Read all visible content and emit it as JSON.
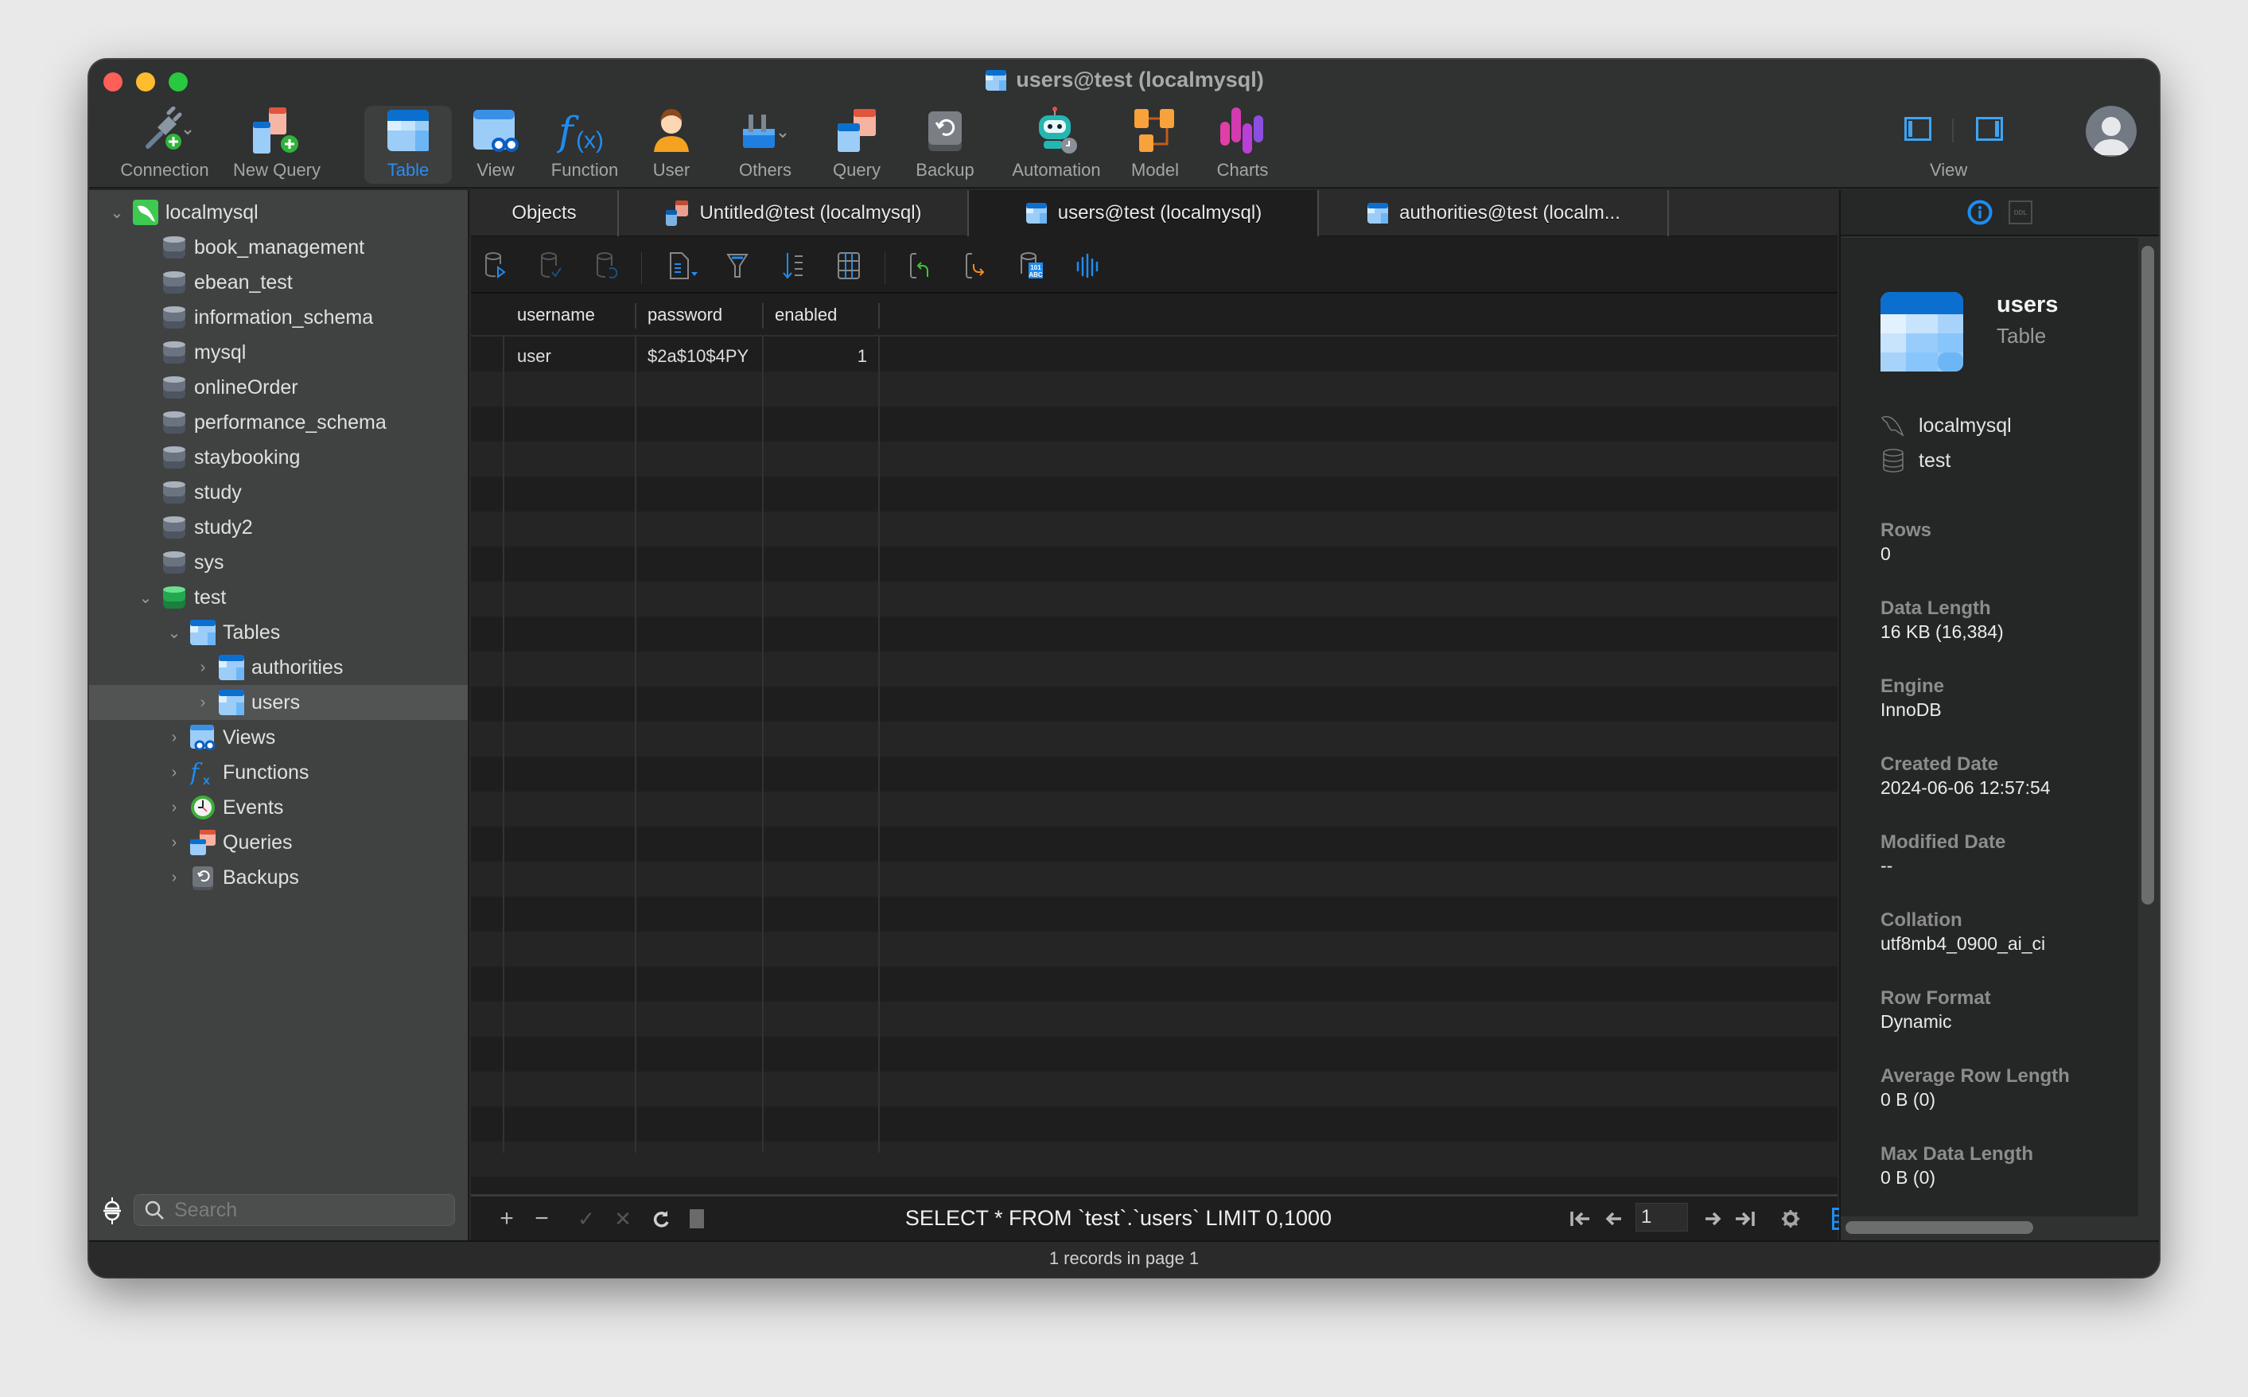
{
  "window": {
    "title": "users@test (localmysql)"
  },
  "toolbar": {
    "items": [
      {
        "label": "Connection",
        "icon": "connection-plug-icon"
      },
      {
        "label": "New Query",
        "icon": "new-query-icon"
      },
      {
        "label": "Table",
        "icon": "table-icon",
        "active": true
      },
      {
        "label": "View",
        "icon": "view-icon"
      },
      {
        "label": "Function",
        "icon": "function-icon"
      },
      {
        "label": "User",
        "icon": "user-icon"
      },
      {
        "label": "Others",
        "icon": "others-tools-icon"
      },
      {
        "label": "Query",
        "icon": "query-icon"
      },
      {
        "label": "Backup",
        "icon": "backup-icon"
      },
      {
        "label": "Automation",
        "icon": "automation-robot-icon"
      },
      {
        "label": "Model",
        "icon": "model-icon"
      },
      {
        "label": "Charts",
        "icon": "charts-icon"
      }
    ],
    "view_label": "View",
    "accent": "#2b8cf0"
  },
  "sidebar": {
    "connection": "localmysql",
    "databases": [
      "book_management",
      "ebean_test",
      "information_schema",
      "mysql",
      "onlineOrder",
      "performance_schema",
      "staybooking",
      "study",
      "study2",
      "sys"
    ],
    "open_database": "test",
    "tables_label": "Tables",
    "tables": [
      "authorities",
      "users"
    ],
    "selected_table": "users",
    "groups": [
      "Views",
      "Functions",
      "Events",
      "Queries",
      "Backups"
    ],
    "search_placeholder": "Search"
  },
  "tabs": [
    {
      "label": "Objects",
      "active": false
    },
    {
      "label": "Untitled@test (localmysql)",
      "active": false
    },
    {
      "label": "users@test (localmysql)",
      "active": true
    },
    {
      "label": "authorities@test (localm...",
      "active": false
    }
  ],
  "grid": {
    "columns": [
      "username",
      "password",
      "enabled"
    ],
    "rows": [
      [
        "user",
        "$2a$10$4PY",
        "1"
      ]
    ]
  },
  "bottombar": {
    "sql": "SELECT * FROM `test`.`users` LIMIT 0,1000",
    "page": "1",
    "status": "1 records in page 1"
  },
  "info": {
    "name": "users",
    "type": "Table",
    "connection": "localmysql",
    "database": "test",
    "properties": [
      {
        "key": "Rows",
        "value": "0"
      },
      {
        "key": "Data Length",
        "value": "16 KB (16,384)"
      },
      {
        "key": "Engine",
        "value": "InnoDB"
      },
      {
        "key": "Created Date",
        "value": "2024-06-06 12:57:54"
      },
      {
        "key": "Modified Date",
        "value": "--"
      },
      {
        "key": "Collation",
        "value": "utf8mb4_0900_ai_ci"
      },
      {
        "key": "Row Format",
        "value": "Dynamic"
      },
      {
        "key": "Average Row Length",
        "value": "0 B (0)"
      },
      {
        "key": "Max Data Length",
        "value": "0 B (0)"
      }
    ],
    "ddl_label": "DDL"
  }
}
